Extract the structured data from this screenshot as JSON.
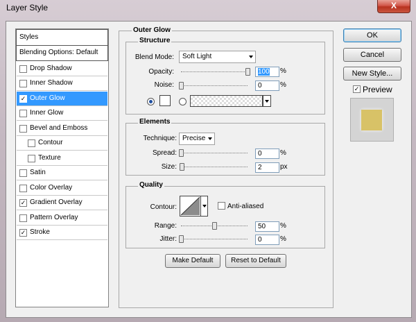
{
  "window": {
    "title": "Layer Style",
    "close_glyph": "X"
  },
  "sidebar": {
    "header": "Styles",
    "items": [
      {
        "label": "Blending Options: Default",
        "checkbox": false,
        "checked": false,
        "indent": false,
        "selected": false
      },
      {
        "label": "Drop Shadow",
        "checkbox": true,
        "checked": false,
        "indent": false,
        "selected": false
      },
      {
        "label": "Inner Shadow",
        "checkbox": true,
        "checked": false,
        "indent": false,
        "selected": false
      },
      {
        "label": "Outer Glow",
        "checkbox": true,
        "checked": true,
        "indent": false,
        "selected": true
      },
      {
        "label": "Inner Glow",
        "checkbox": true,
        "checked": false,
        "indent": false,
        "selected": false
      },
      {
        "label": "Bevel and Emboss",
        "checkbox": true,
        "checked": false,
        "indent": false,
        "selected": false
      },
      {
        "label": "Contour",
        "checkbox": true,
        "checked": false,
        "indent": true,
        "selected": false
      },
      {
        "label": "Texture",
        "checkbox": true,
        "checked": false,
        "indent": true,
        "selected": false
      },
      {
        "label": "Satin",
        "checkbox": true,
        "checked": false,
        "indent": false,
        "selected": false
      },
      {
        "label": "Color Overlay",
        "checkbox": true,
        "checked": false,
        "indent": false,
        "selected": false
      },
      {
        "label": "Gradient Overlay",
        "checkbox": true,
        "checked": true,
        "indent": false,
        "selected": false
      },
      {
        "label": "Pattern Overlay",
        "checkbox": true,
        "checked": false,
        "indent": false,
        "selected": false
      },
      {
        "label": "Stroke",
        "checkbox": true,
        "checked": true,
        "indent": false,
        "selected": false
      }
    ]
  },
  "panel": {
    "title": "Outer Glow",
    "structure": {
      "title": "Structure",
      "blend_mode_label": "Blend Mode:",
      "blend_mode_value": "Soft Light",
      "opacity_label": "Opacity:",
      "opacity_value": "100",
      "opacity_fraction": 1.0,
      "noise_label": "Noise:",
      "noise_value": "0",
      "noise_fraction": 0.0,
      "percent": "%"
    },
    "elements": {
      "title": "Elements",
      "technique_label": "Technique:",
      "technique_value": "Precise",
      "spread_label": "Spread:",
      "spread_value": "0",
      "spread_fraction": 0.0,
      "size_label": "Size:",
      "size_value": "2",
      "size_fraction": 0.01,
      "percent": "%",
      "px": "px"
    },
    "quality": {
      "title": "Quality",
      "contour_label": "Contour:",
      "anti_aliased_label": "Anti-aliased",
      "anti_aliased_checked": false,
      "range_label": "Range:",
      "range_value": "50",
      "range_fraction": 0.5,
      "jitter_label": "Jitter:",
      "jitter_value": "0",
      "jitter_fraction": 0.0,
      "percent": "%"
    },
    "make_default_label": "Make Default",
    "reset_default_label": "Reset to Default"
  },
  "right": {
    "ok_label": "OK",
    "cancel_label": "Cancel",
    "new_style_label": "New Style...",
    "preview_label": "Preview",
    "preview_checked": true,
    "preview_color": "#d8c267"
  },
  "colors": {
    "selection": "#3399ff",
    "glow_color": "#ffffff"
  }
}
